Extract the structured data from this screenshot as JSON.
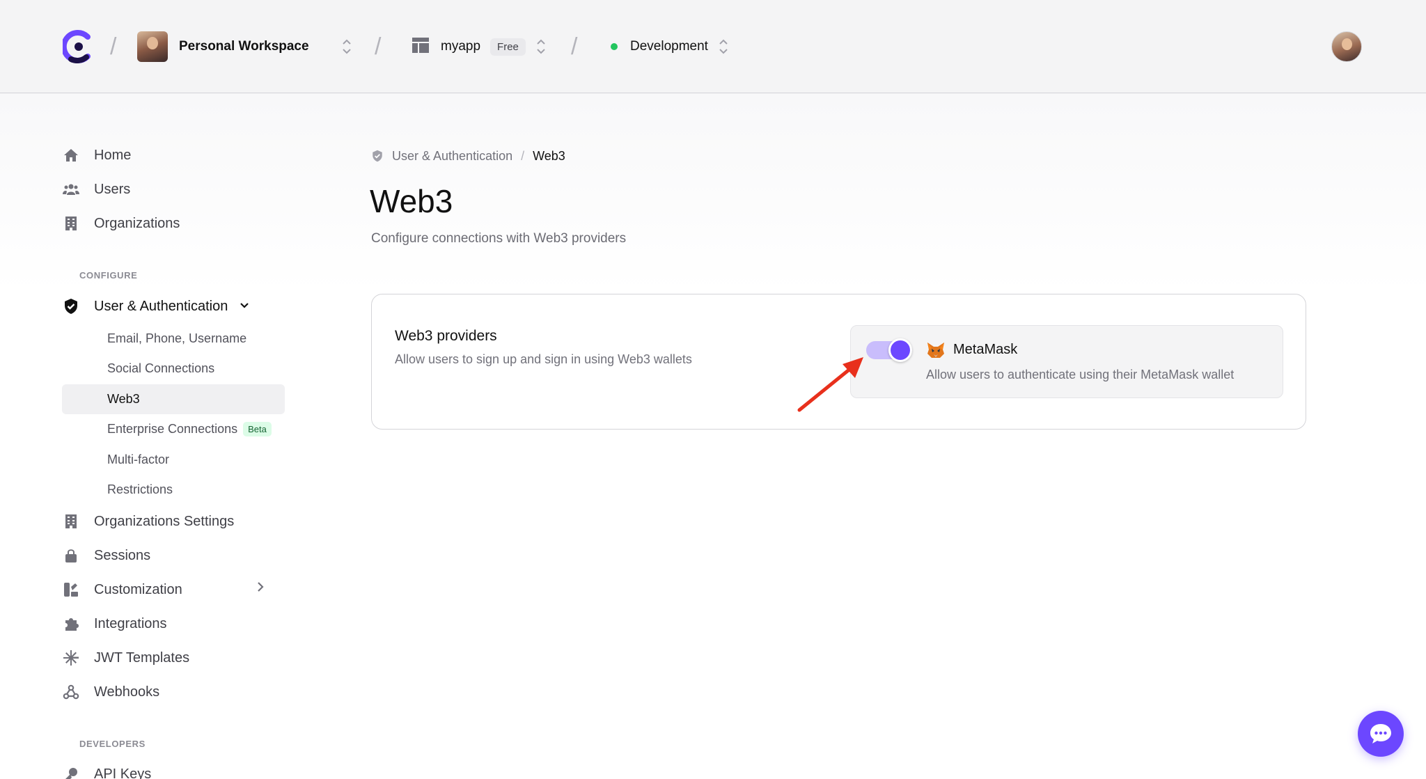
{
  "topbar": {
    "workspace": "Personal Workspace",
    "app_name": "myapp",
    "app_plan": "Free",
    "environment": "Development",
    "separator": "/"
  },
  "sidebar": {
    "items_top": [
      {
        "label": "Home",
        "icon": "home-icon"
      },
      {
        "label": "Users",
        "icon": "users-icon"
      },
      {
        "label": "Organizations",
        "icon": "building-icon"
      }
    ],
    "configure_label": "CONFIGURE",
    "auth_parent": {
      "label": "User & Authentication",
      "icon": "shield-check-icon"
    },
    "auth_children": [
      {
        "label": "Email, Phone, Username"
      },
      {
        "label": "Social Connections"
      },
      {
        "label": "Web3",
        "active": true
      },
      {
        "label": "Enterprise Connections",
        "badge": "Beta"
      },
      {
        "label": "Multi-factor"
      },
      {
        "label": "Restrictions"
      }
    ],
    "items_bottom": [
      {
        "label": "Organizations Settings",
        "icon": "building-icon"
      },
      {
        "label": "Sessions",
        "icon": "lock-icon"
      },
      {
        "label": "Customization",
        "icon": "brush-icon"
      },
      {
        "label": "Integrations",
        "icon": "puzzle-icon"
      },
      {
        "label": "JWT Templates",
        "icon": "asterisk-icon"
      },
      {
        "label": "Webhooks",
        "icon": "webhook-icon"
      }
    ],
    "developers_label": "DEVELOPERS",
    "api_keys": {
      "label": "API Keys",
      "icon": "key-icon"
    }
  },
  "breadcrumb": {
    "parent": "User & Authentication",
    "separator": "/",
    "current": "Web3"
  },
  "page": {
    "title": "Web3",
    "subtitle": "Configure connections with Web3 providers"
  },
  "card": {
    "title": "Web3 providers",
    "description": "Allow users to sign up and sign in using Web3 wallets",
    "provider": {
      "name": "MetaMask",
      "description": "Allow users to authenticate using their MetaMask wallet",
      "enabled": true
    }
  },
  "colors": {
    "accent": "#6c47ff",
    "toggle_track": "#c9bdfc",
    "env_dot": "#22c55e",
    "annotation_arrow": "#e8301c"
  }
}
